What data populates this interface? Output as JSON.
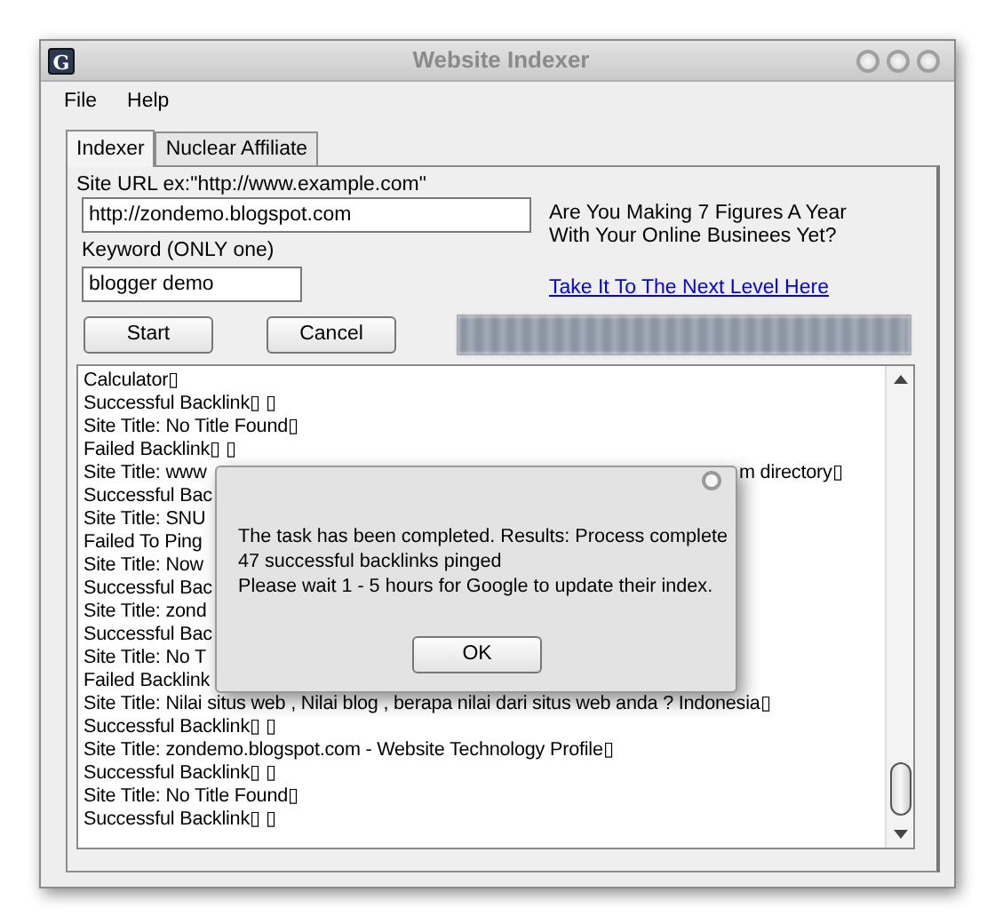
{
  "window": {
    "app_icon_letter": "G",
    "title": "Website Indexer"
  },
  "menu": [
    "File",
    "Help"
  ],
  "tabs": [
    {
      "label": "Indexer",
      "selected": true
    },
    {
      "label": "Nuclear Affiliate",
      "selected": false
    }
  ],
  "form": {
    "url_label": "Site URL ex:\"http://www.example.com\"",
    "url_value": "http://zondemo.blogspot.com",
    "keyword_label": "Keyword (ONLY one)",
    "keyword_value": "blogger demo"
  },
  "buttons": [
    "Start",
    "Cancel"
  ],
  "progress": {
    "level": 1
  },
  "promo": {
    "text_lines": [
      "Are You Making 7 Figures A Year",
      "With Your Online Businees Yet?"
    ],
    "link": "Take It To The Next Level Here"
  },
  "log": [
    {
      "text": "Calculator▯"
    },
    {
      "text": "Successful Backlink▯ ▯"
    },
    {
      "text": "Site Title: No Title Found▯"
    },
    {
      "text": "Failed Backlink▯ ▯"
    },
    {
      "text": "Site Title: www",
      "tail": "m directory▯"
    },
    {
      "text": "Successful Bac"
    },
    {
      "text": "Site Title: SNU"
    },
    {
      "text": "Failed To Ping"
    },
    {
      "text": "Site Title: Now"
    },
    {
      "text": "Successful Bac"
    },
    {
      "text": "Site Title: zond"
    },
    {
      "text": "Successful Bac"
    },
    {
      "text": "Site Title: No T"
    },
    {
      "text": "Failed Backlink"
    },
    {
      "text": "Site Title: Nilai situs web , Nilai blog , berapa nilai dari situs web anda ? Indonesia▯"
    },
    {
      "text": "Successful Backlink▯ ▯"
    },
    {
      "text": "Site Title: zondemo.blogspot.com - Website Technology Profile▯"
    },
    {
      "text": "Successful Backlink▯ ▯"
    },
    {
      "text": "Site Title: No Title Found▯"
    },
    {
      "text": "Successful Backlink▯ ▯"
    }
  ],
  "dialog": {
    "lines": [
      "The task has been completed. Results: Process complete",
      "47 successful backlinks pinged",
      "Please wait 1 - 5 hours for Google to update their index."
    ],
    "button": "OK"
  }
}
